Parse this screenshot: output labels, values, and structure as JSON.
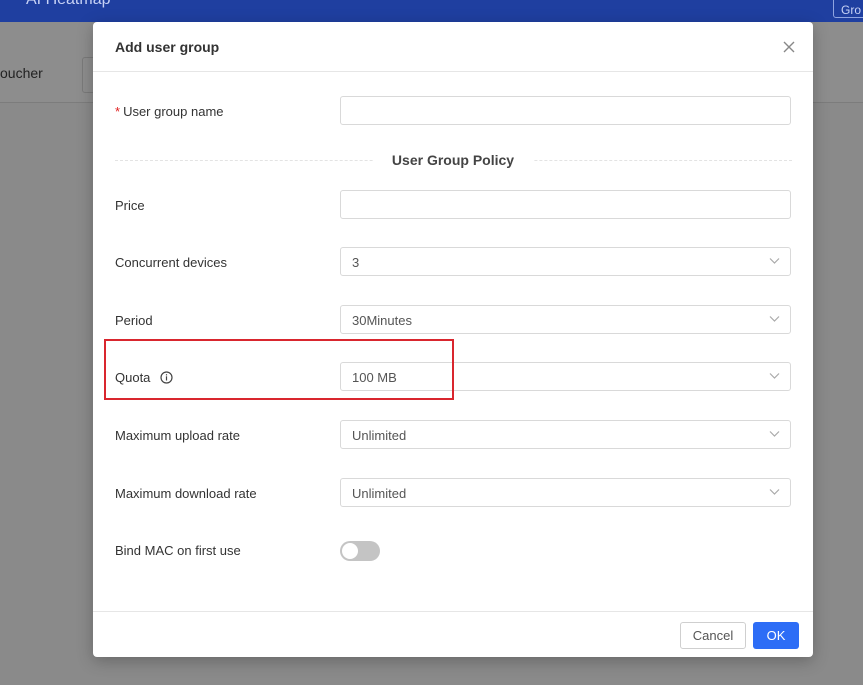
{
  "background": {
    "header_title": "AI Heatmap",
    "header_button": "Gro",
    "subbar_tab": "oucher"
  },
  "modal": {
    "title": "Add user group",
    "fields": {
      "group_name": {
        "label": "User group name",
        "value": "",
        "required": true
      },
      "section_title": "User Group Policy",
      "price": {
        "label": "Price",
        "value": ""
      },
      "concurrent": {
        "label": "Concurrent devices",
        "value": "3"
      },
      "period": {
        "label": "Period",
        "value": "30Minutes"
      },
      "quota": {
        "label": "Quota",
        "value": "100 MB",
        "icon": "info-icon"
      },
      "upload": {
        "label": "Maximum upload rate",
        "value": "Unlimited"
      },
      "download": {
        "label": "Maximum download rate",
        "value": "Unlimited"
      },
      "bind_mac": {
        "label": "Bind MAC on first use",
        "enabled": false
      }
    },
    "footer": {
      "cancel_label": "Cancel",
      "ok_label": "OK"
    }
  },
  "colors": {
    "primary": "#2d6df6",
    "highlight_box": "#d9262e",
    "required": "#e02020"
  }
}
